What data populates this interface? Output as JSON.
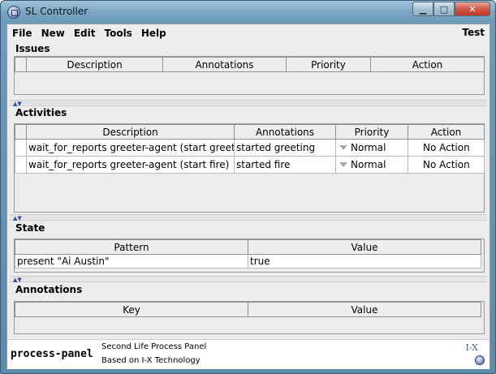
{
  "window": {
    "title": "SL Controller",
    "minimize_glyph": "▁",
    "maximize_glyph": "□",
    "close_glyph": "✕"
  },
  "menu": {
    "items": [
      "File",
      "New",
      "Edit",
      "Tools",
      "Help"
    ],
    "right_label": "Test"
  },
  "issues": {
    "title": "Issues",
    "columns": [
      "Description",
      "Annotations",
      "Priority",
      "Action"
    ]
  },
  "activities": {
    "title": "Activities",
    "columns": [
      "Description",
      "Annotations",
      "Priority",
      "Action"
    ],
    "rows": [
      {
        "description": "wait_for_reports greeter-agent (start greeting)",
        "annotations": "started greeting",
        "priority": "Normal",
        "action": "No Action",
        "highlight": false
      },
      {
        "description": "wait_for_reports greeter-agent (start fire)",
        "annotations": "started fire",
        "priority": "Normal",
        "action": "No Action",
        "highlight": true
      }
    ]
  },
  "state": {
    "title": "State",
    "columns": [
      "Pattern",
      "Value"
    ],
    "rows": [
      {
        "pattern": "present \"Ai Austin\"",
        "value": "true"
      }
    ]
  },
  "annotations": {
    "title": "Annotations",
    "columns": [
      "Key",
      "Value"
    ]
  },
  "footer": {
    "name": "process-panel",
    "line1": "Second Life Process Panel",
    "line2": "Based on I-X Technology",
    "logo_text": "I-X"
  },
  "colors": {
    "highlight_row": "#f5c5c4",
    "action_cell": "#6ad7ea"
  },
  "icons": {
    "app": "ix-globe-icon",
    "splitter": "splitter-arrows-icon",
    "dropdown": "dropdown-arrow-icon"
  }
}
